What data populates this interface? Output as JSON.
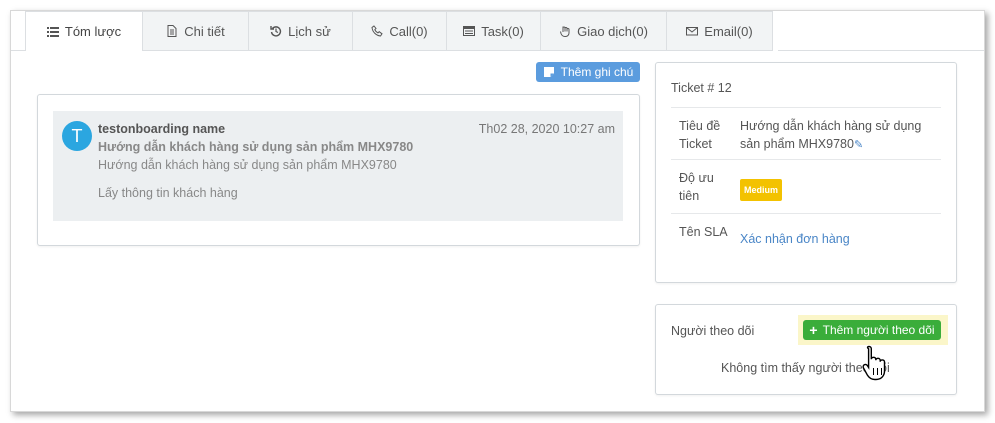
{
  "tabs": [
    {
      "label": "Tóm lược",
      "icon": "list-icon"
    },
    {
      "label": "Chi tiết",
      "icon": "document-icon"
    },
    {
      "label": "Lịch sử",
      "icon": "history-icon"
    },
    {
      "label": "Call(0)",
      "icon": "phone-icon"
    },
    {
      "label": "Task(0)",
      "icon": "tasks-icon"
    },
    {
      "label": "Giao dịch(0)",
      "icon": "hand-icon"
    },
    {
      "label": "Email(0)",
      "icon": "envelope-icon"
    }
  ],
  "add_note_label": "Thêm ghi chú",
  "note": {
    "avatar_letter": "T",
    "author": "testonboarding name",
    "time": "Th02 28, 2020 10:27 am",
    "subject": "Hướng dẫn khách hàng sử dụng sản phẩm MHX9780",
    "body": "Hướng dẫn khách hàng sử dụng sản phẩm MHX9780",
    "extra": "Lấy thông tin khách hàng"
  },
  "ticket": {
    "title": "Ticket # 12",
    "rows": [
      {
        "label": "Tiêu đề Ticket",
        "value": "Hướng dẫn khách hàng sử dụng sản phẩm MHX9780"
      },
      {
        "label": "Độ ưu tiên",
        "value": "Medium"
      },
      {
        "label": "Tên SLA",
        "value": "Xác nhận đơn hàng"
      }
    ]
  },
  "followers": {
    "label": "Người theo dõi",
    "add_label": "Thêm người theo dõi",
    "empty_text": "Không tìm thấy người theo dõi"
  },
  "colors": {
    "note_button": "#5b9cde",
    "add_follower_button": "#3aad3a",
    "medium_badge": "#f3c200",
    "link": "#4a86c7",
    "avatar": "#2ba6e0"
  }
}
